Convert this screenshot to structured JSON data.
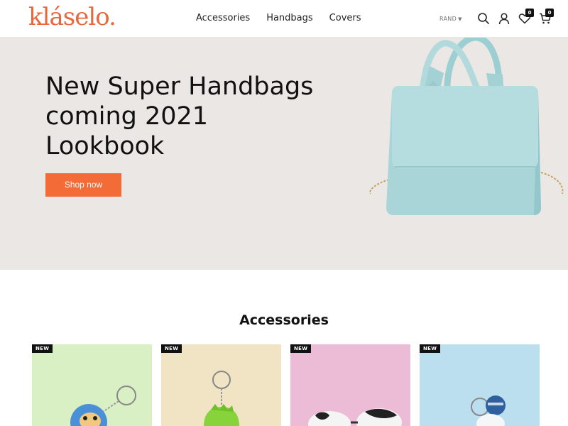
{
  "header": {
    "logo": "kláselo.",
    "nav": [
      "Accessories",
      "Handbags",
      "Covers"
    ],
    "currency": "RAND",
    "wishlist_count": "0",
    "cart_count": "0"
  },
  "hero": {
    "title": "New Super Handbags coming 2021 Lookbook",
    "button": "Shop now",
    "colors": {
      "background": "#ebe7e5",
      "button": "#f36b37",
      "bag": "#a9d3d6"
    }
  },
  "accessories": {
    "title": "Accessories",
    "badge": "NEW",
    "cards": [
      {
        "bg": "#d9efc4",
        "badge": "NEW",
        "item": "blue monkey keychain"
      },
      {
        "bg": "#f1e4c4",
        "badge": "NEW",
        "item": "green dinosaur keychain"
      },
      {
        "bg": "#ecbcd6",
        "badge": "NEW",
        "item": "cow keychain"
      },
      {
        "bg": "#bcdff0",
        "badge": "NEW",
        "item": "astronaut keychain"
      }
    ]
  },
  "brand_color": "#e8673b"
}
